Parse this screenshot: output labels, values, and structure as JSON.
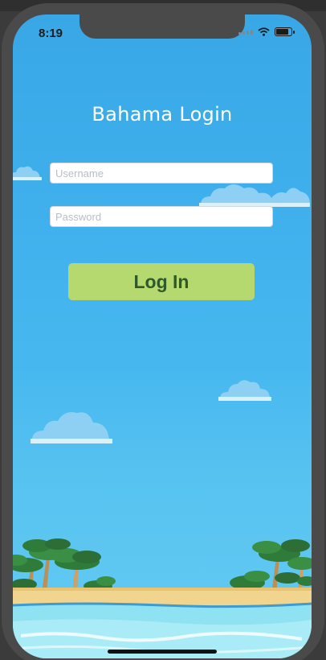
{
  "status_bar": {
    "time": "8:19"
  },
  "login": {
    "title": "Bahama Login",
    "username_placeholder": "Username",
    "password_placeholder": "Password",
    "username_value": "",
    "password_value": "",
    "login_label": "Log In"
  },
  "colors": {
    "sky": "#3fb0ec",
    "button": "#b5d86f",
    "button_text": "#2e5a2a",
    "sand": "#f1d58f",
    "water": "#8fe2f2"
  }
}
